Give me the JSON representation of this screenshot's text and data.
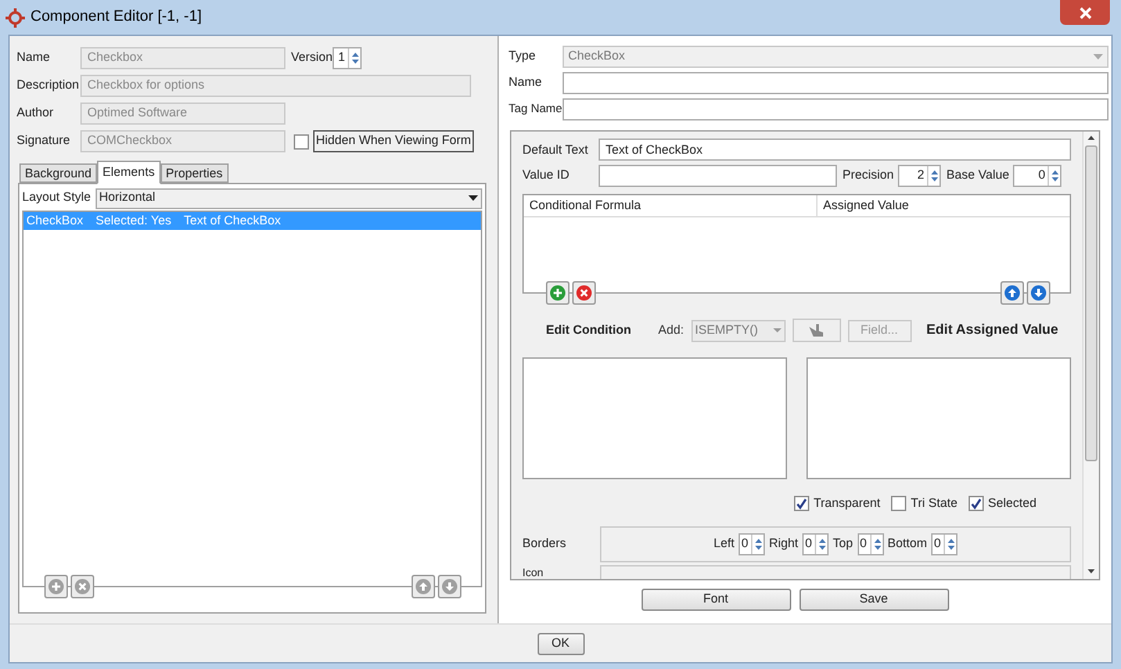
{
  "window": {
    "title": "Component Editor [-1, -1]"
  },
  "component": {
    "name_label": "Name",
    "name": "Checkbox",
    "version_label": "Version",
    "version": "1",
    "description_label": "Description",
    "description": "Checkbox for options",
    "author_label": "Author",
    "author": "Optimed Software",
    "signature_label": "Signature",
    "signature": "COMCheckbox",
    "hidden_label": "Hidden When Viewing Form",
    "hidden_checked": false
  },
  "tabs": [
    {
      "label": "Background",
      "selected": false
    },
    {
      "label": "Elements",
      "selected": true
    },
    {
      "label": "Properties",
      "selected": false
    }
  ],
  "layout_style": {
    "label": "Layout Style",
    "value": "Horizontal"
  },
  "elements": [
    {
      "cells": [
        "CheckBox",
        "Selected: Yes",
        "Text of CheckBox"
      ],
      "selected": true
    }
  ],
  "element": {
    "type_label": "Type",
    "type": "CheckBox",
    "name_label": "Name",
    "tag_label": "Tag Name",
    "default_text_label": "Default Text",
    "default_text": "Text of CheckBox",
    "value_id_label": "Value ID",
    "precision_label": "Precision",
    "precision": "2",
    "base_value_label": "Base Value",
    "base_value": "0",
    "formula_columns": [
      "Conditional Formula",
      "Assigned Value"
    ],
    "edit_condition": "Edit Condition",
    "add_label": "Add:",
    "add_value": "ISEMPTY()",
    "field_button": "Field...",
    "edit_assigned": "Edit Assigned Value",
    "options": [
      {
        "label": "Transparent",
        "checked": true
      },
      {
        "label": "Tri State",
        "checked": false
      },
      {
        "label": "Selected",
        "checked": true
      }
    ],
    "borders_label": "Borders",
    "borders": [
      {
        "label": "Left",
        "value": "0"
      },
      {
        "label": "Right",
        "value": "0"
      },
      {
        "label": "Top",
        "value": "0"
      },
      {
        "label": "Bottom",
        "value": "0"
      }
    ],
    "icon_label": "Icon"
  },
  "buttons": [
    "Font",
    "Save"
  ],
  "ok": "OK"
}
